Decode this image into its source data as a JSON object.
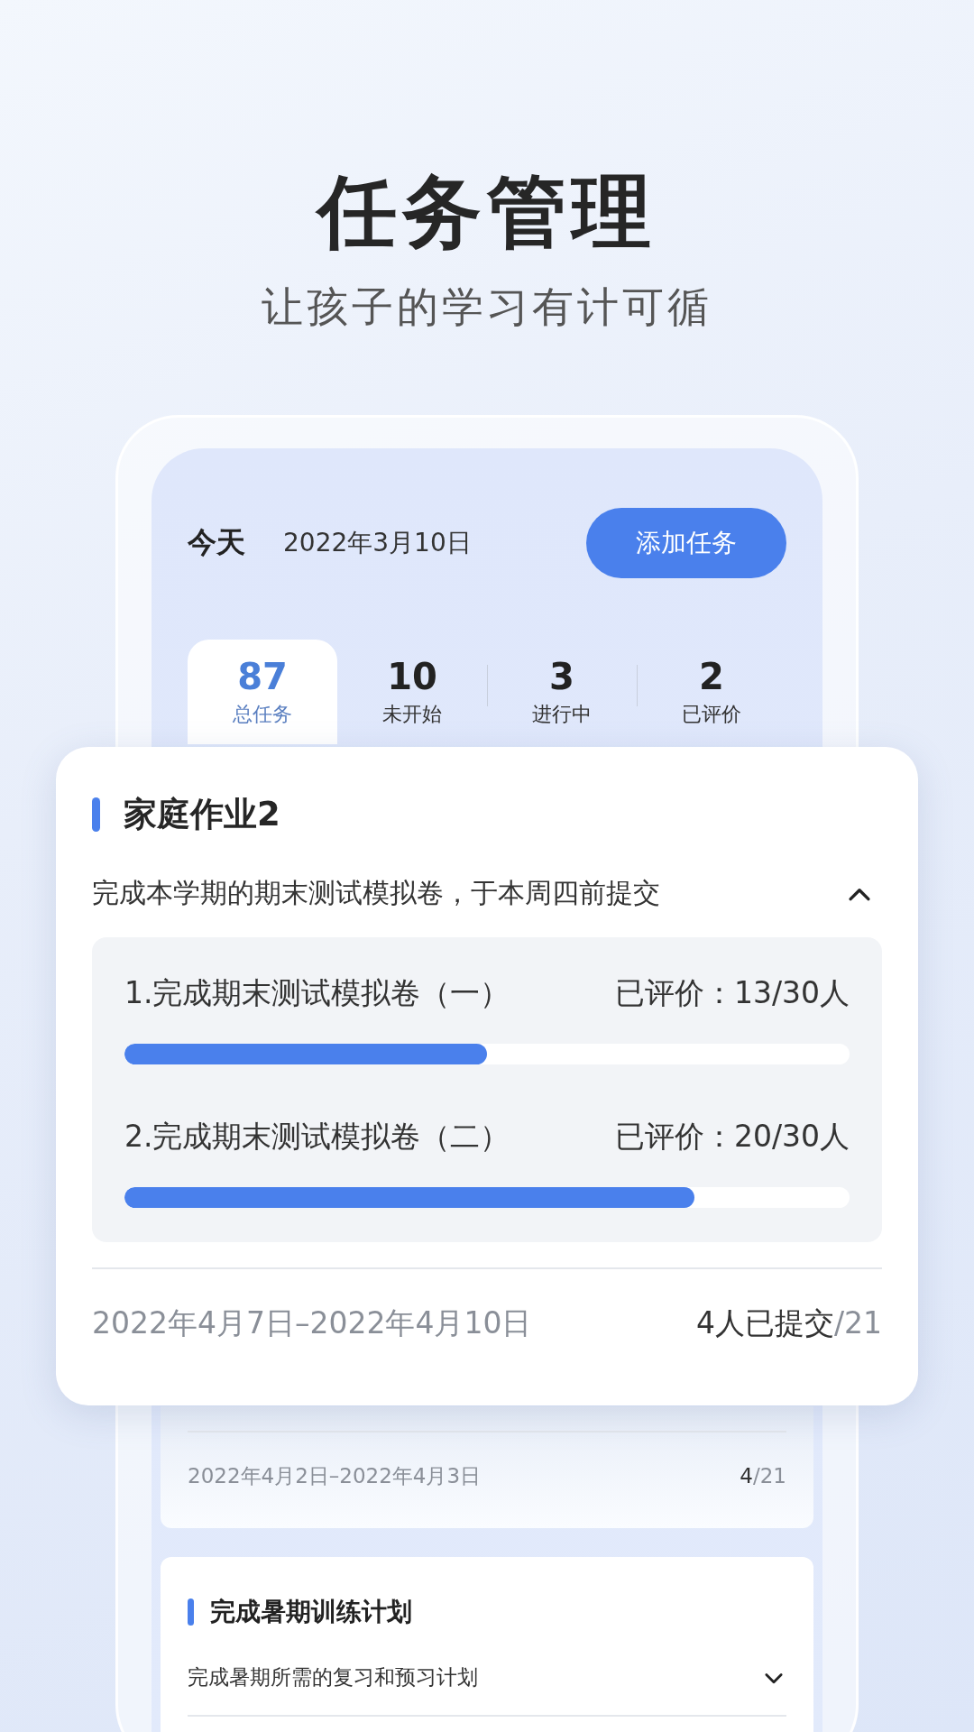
{
  "headline": "任务管理",
  "subheadline": "让孩子的学习有计可循",
  "header": {
    "today": "今天",
    "date": "2022年3月10日",
    "add_button": "添加任务"
  },
  "stats": [
    {
      "value": "87",
      "label": "总任务",
      "selected": true
    },
    {
      "value": "10",
      "label": "未开始",
      "selected": false
    },
    {
      "value": "3",
      "label": "进行中",
      "selected": false
    },
    {
      "value": "2",
      "label": "已评价",
      "selected": false
    }
  ],
  "focus_card": {
    "title": "家庭作业2",
    "description": "完成本学期的期末测试模拟卷，于本周四前提交",
    "expanded": true,
    "items": [
      {
        "name": "1.完成期末测试模拟卷（一）",
        "reading": "已评价：13/30人",
        "level": 0.5
      },
      {
        "name": "2.完成期末测试模拟卷（二）",
        "reading": "已评价：20/30人",
        "level": 0.786
      }
    ],
    "dates": "2022年4月7日–2022年4月10日",
    "submitted": "4人已提交",
    "total": "/21"
  },
  "list_cards": [
    {
      "dates": "2022年4月2日–2022年4月3日",
      "submitted": "4",
      "total": "/21"
    },
    {
      "title": "完成暑期训练计划",
      "description": "完成暑期所需的复习和预习计划",
      "expanded": false
    }
  ]
}
